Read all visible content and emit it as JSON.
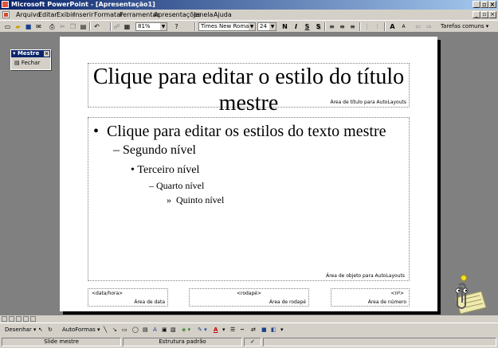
{
  "window": {
    "title": "Microsoft PowerPoint - [Apresentação1]"
  },
  "menu": [
    "Arquivo",
    "Editar",
    "Exibir",
    "Inserir",
    "Formatar",
    "Ferramentas",
    "Apresentações",
    "Janela",
    "Ajuda"
  ],
  "toolbar": {
    "zoom": "81%",
    "font_name": "Times New Roman",
    "font_size": "24",
    "bold": "N",
    "italic": "I",
    "shadow": "S",
    "underline": "S",
    "tasks": "Tarefas comuns"
  },
  "master_toolbar": {
    "title": "Mestre",
    "close_label": "Fechar"
  },
  "slide": {
    "title": "Clique para editar o estilo do título mestre",
    "title_area_label": "Área de título para AutoLayouts",
    "bullets": [
      "Clique para editar os estilos do texto mestre",
      "Segundo nível",
      "Terceiro nível",
      "Quarto nível",
      "Quinto nível"
    ],
    "bullet_marks": [
      "•",
      "–",
      "•",
      "–",
      "»"
    ],
    "object_area_label": "Área de objeto para AutoLayouts",
    "footer": {
      "date_text": "<data/hora>",
      "date_label": "Área de data",
      "footer_text": "<rodapé>",
      "footer_label": "Área de rodapé",
      "number_text": "<nº>",
      "number_label": "Área de número"
    }
  },
  "drawing_toolbar": {
    "draw_label": "Desenhar",
    "autoshapes_label": "AutoFormas"
  },
  "status": {
    "view": "Slide mestre",
    "design": "Estrutura padrão"
  },
  "colors": {
    "title_blue": "#0a246a",
    "chrome": "#d4d0c8",
    "workspace": "#808080"
  }
}
